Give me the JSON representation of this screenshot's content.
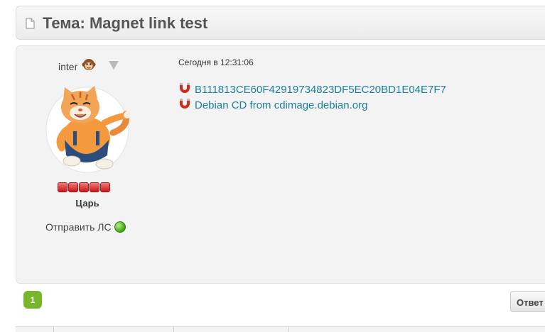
{
  "topic": {
    "title": "Тема: Magnet link test",
    "icons": {
      "header": "document-icon"
    }
  },
  "post": {
    "author": {
      "username": "inter",
      "status_icon": "monkey-icon",
      "menu_icon": "dropdown-triangle-icon",
      "avatar": "cat-avatar",
      "rank_pips": 5,
      "rank_title": "Царь",
      "send_pm_label": "Отправить ЛС",
      "online_icon": "online-status-icon"
    },
    "date": "Сегодня в 12:31:06",
    "links": [
      {
        "text": "B111813CE60F42919734823DF5EC20BD1E04E7F7",
        "icon": "magnet-icon"
      },
      {
        "text": "Debian CD from cdimage.debian.org",
        "icon": "magnet-icon"
      }
    ]
  },
  "pagination": {
    "current_page": "1"
  },
  "actions": {
    "reply_label": "Ответ"
  },
  "colors": {
    "link": "#1b7fa0",
    "page_button": "#77b52a",
    "rank_pip": "#d62d2d",
    "online": "#4caf1c"
  }
}
